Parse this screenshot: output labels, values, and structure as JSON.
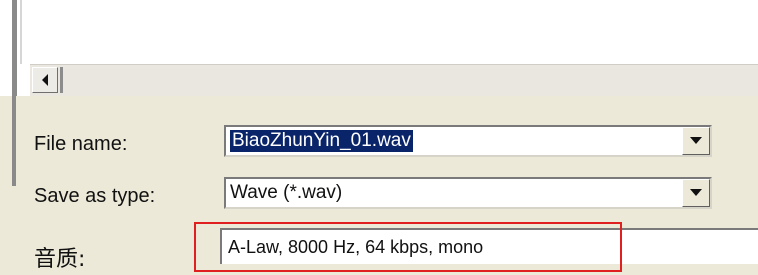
{
  "file_name_label": "File name:",
  "file_name_value": "BiaoZhunYin_01.wav",
  "save_as_type_label": "Save as type:",
  "save_as_type_value": "Wave (*.wav)",
  "quality_label": "音质:",
  "quality_value": "A-Law, 8000 Hz, 64 kbps, mono",
  "icons": {
    "scroll_left": "scroll-left-arrow-icon",
    "dropdown": "dropdown-arrow-icon"
  },
  "colors": {
    "dialog_background": "#ece9d8",
    "selection_highlight": "#0a246a",
    "annotation_box": "#e02020"
  }
}
